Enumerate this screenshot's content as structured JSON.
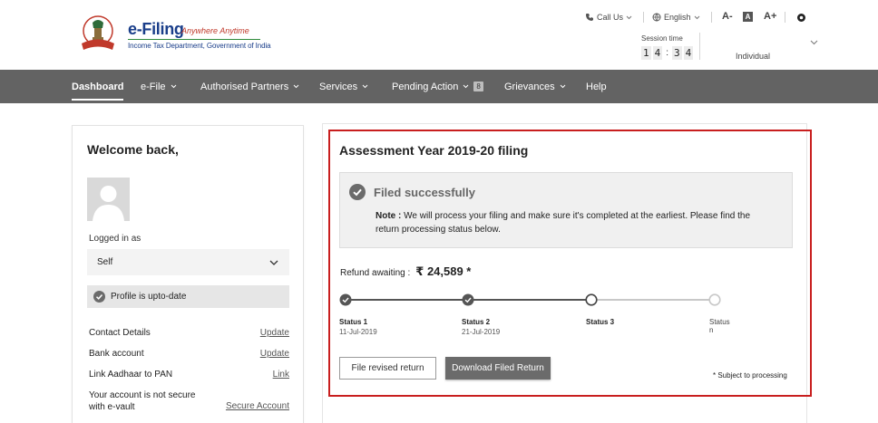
{
  "header": {
    "logo_title": "e-Filing",
    "logo_tagline": "Anywhere Anytime",
    "logo_dept": "Income Tax Department, Government of India",
    "call_us": "Call Us",
    "language": "English",
    "font_decrease": "A-",
    "font_normal": "A",
    "font_increase": "A+",
    "session_label": "Session time",
    "session_digits": [
      "1",
      "4",
      "3",
      "4"
    ],
    "session_colon": ":",
    "user_type": "Individual"
  },
  "nav": {
    "items": [
      {
        "label": "Dashboard"
      },
      {
        "label": "e-File"
      },
      {
        "label": "Authorised Partners"
      },
      {
        "label": "Services"
      },
      {
        "label": "Pending Action"
      },
      {
        "label": "Grievances"
      },
      {
        "label": "Help"
      }
    ],
    "pending_badge": "8"
  },
  "profile": {
    "welcome": "Welcome back,",
    "logged_in_as": "Logged in as",
    "role": "Self",
    "status": "Profile is upto-date",
    "rows": [
      {
        "label": "Contact Details",
        "link": "Update"
      },
      {
        "label": "Bank account",
        "link": "Update"
      },
      {
        "label": "Link Aadhaar to PAN",
        "link": "Link"
      },
      {
        "label_line1": "Your account is not secure",
        "label_line2": "with e-vault",
        "link": "Secure Account"
      }
    ]
  },
  "filing": {
    "title": "Assessment Year 2019-20 filing",
    "status_heading": "Filed successfully",
    "note_label": "Note :",
    "note_text": "We will process your filing and make sure it's completed at the earliest. Please find the return processing status below.",
    "refund_label": "Refund awaiting :",
    "refund_amount": "₹ 24,589 *",
    "steps": [
      {
        "label": "Status 1",
        "date": "11-Jul-2019",
        "state": "done"
      },
      {
        "label": "Status 2",
        "date": "21-Jul-2019",
        "state": "done"
      },
      {
        "label": "Status 3",
        "date": "",
        "state": "current"
      },
      {
        "label": "Status n",
        "date": "",
        "state": "pending"
      }
    ],
    "btn_revised": "File revised return",
    "btn_download": "Download Filed Return",
    "subject_note": "* Subject to processing"
  },
  "colors": {
    "nav_bg": "#636363",
    "highlight_border": "#c81e1e",
    "logo_blue": "#1a3e8a",
    "tagline_red": "#c0392b",
    "step_done": "#555555",
    "step_pending": "#c8c8c8"
  },
  "icons": [
    "emblem-logo",
    "phone-icon",
    "globe-icon",
    "chevron-down-icon",
    "settings-icon",
    "check-circle-icon",
    "avatar-placeholder"
  ]
}
